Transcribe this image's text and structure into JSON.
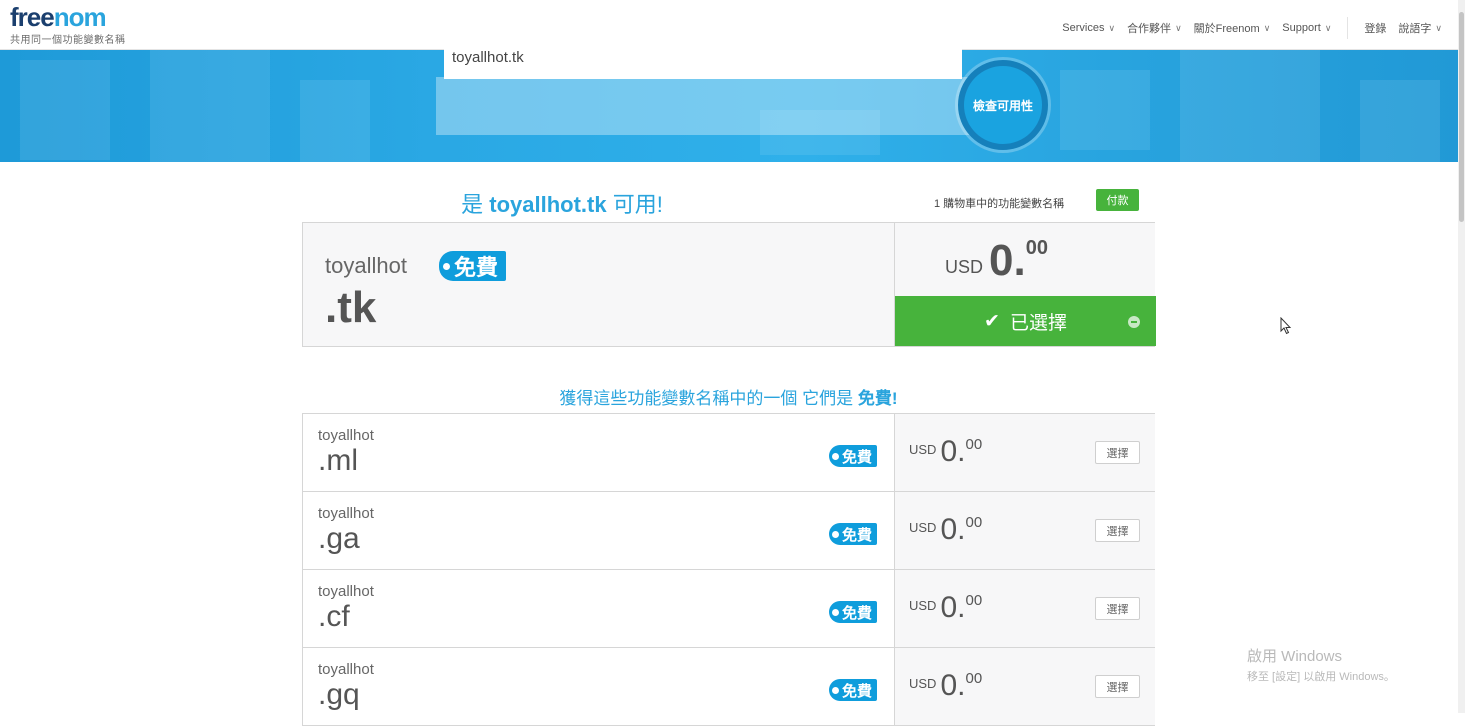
{
  "header": {
    "logo_free": "free",
    "logo_nom": "nom",
    "logo_sub": "共用同一個功能變數名稱",
    "nav": [
      {
        "label": "Services"
      },
      {
        "label": "合作夥伴"
      },
      {
        "label": "關於Freenom"
      },
      {
        "label": "Support"
      }
    ],
    "login_label": "登錄",
    "language_label": "說語字"
  },
  "search": {
    "value": "toyallhot.tk",
    "button_label": "檢查可用性"
  },
  "result": {
    "prefix": "是",
    "domain": "toyallhot.tk",
    "suffix": "可用!",
    "cart_info": "1 購物車中的功能變數名稱",
    "pay_label": "付款"
  },
  "main_offer": {
    "name": "toyallhot",
    "tld": ".tk",
    "badge": "免費",
    "currency": "USD",
    "price_int": "0.",
    "price_dec": "00",
    "selected_label": "已選擇"
  },
  "alternatives": {
    "title_prefix": "獲得這些功能變數名稱中的一個 它們是",
    "title_free": "免費!",
    "items": [
      {
        "name": "toyallhot",
        "tld": ".ml",
        "badge": "免費",
        "currency": "USD",
        "price_int": "0.",
        "price_dec": "00",
        "select_label": "選擇"
      },
      {
        "name": "toyallhot",
        "tld": ".ga",
        "badge": "免費",
        "currency": "USD",
        "price_int": "0.",
        "price_dec": "00",
        "select_label": "選擇"
      },
      {
        "name": "toyallhot",
        "tld": ".cf",
        "badge": "免費",
        "currency": "USD",
        "price_int": "0.",
        "price_dec": "00",
        "select_label": "選擇"
      },
      {
        "name": "toyallhot",
        "tld": ".gq",
        "badge": "免費",
        "currency": "USD",
        "price_int": "0.",
        "price_dec": "00",
        "select_label": "選擇"
      }
    ]
  },
  "watermark": {
    "line1": "啟用 Windows",
    "line2": "移至 [設定] 以啟用 Windows。"
  },
  "colors": {
    "brand_blue": "#2aa4dd",
    "brand_navy": "#1b3f6e",
    "badge_blue": "#0f9ddc",
    "success_green": "#47b33c"
  }
}
